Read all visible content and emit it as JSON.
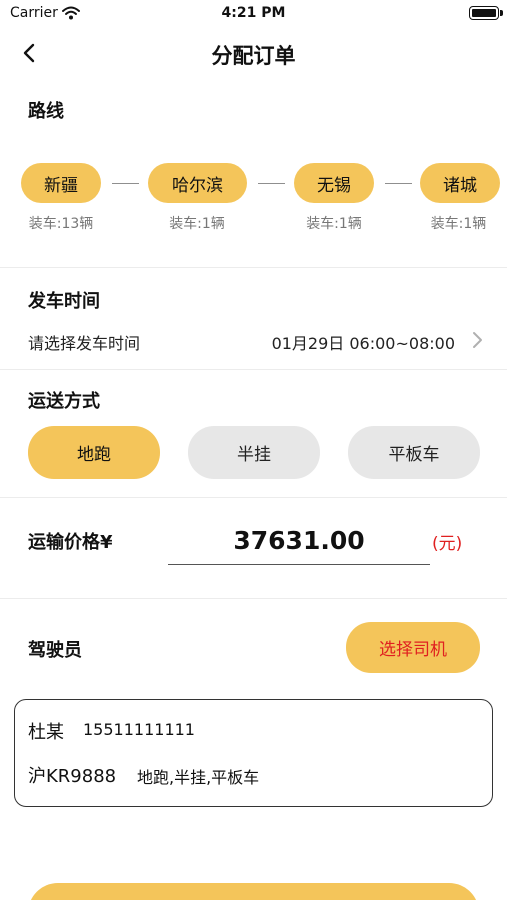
{
  "status_bar": {
    "carrier": "Carrier",
    "time": "4:21 PM",
    "icons": [
      "wifi-icon",
      "battery-icon"
    ]
  },
  "nav": {
    "title": "分配订单",
    "back_icon": "chevron-left-icon"
  },
  "route": {
    "title": "路线",
    "stops": [
      {
        "city": "新疆",
        "load": "装车:13辆"
      },
      {
        "city": "哈尔滨",
        "load": "装车:1辆"
      },
      {
        "city": "无锡",
        "load": "装车:1辆"
      },
      {
        "city": "诸城",
        "load": "装车:1辆"
      }
    ]
  },
  "departure": {
    "title": "发车时间",
    "label": "请选择发车时间",
    "value": "01月29日 06:00~08:00",
    "chevron_icon": "chevron-right-icon"
  },
  "transport": {
    "title": "运送方式",
    "options": [
      {
        "label": "地跑",
        "selected": true
      },
      {
        "label": "半挂",
        "selected": false
      },
      {
        "label": "平板车",
        "selected": false
      }
    ]
  },
  "price": {
    "label": "运输价格¥",
    "value": "37631.00",
    "unit": "(元)"
  },
  "driver": {
    "label": "驾驶员",
    "choose_button": "选择司机",
    "name": "杜某",
    "phone": "15511111111",
    "plate": "沪KR9888",
    "vehicle_types": "地跑,半挂,平板车"
  },
  "colors": {
    "accent": "#f4c55a",
    "inactive": "#e7e7e7",
    "alert": "#e02020"
  }
}
